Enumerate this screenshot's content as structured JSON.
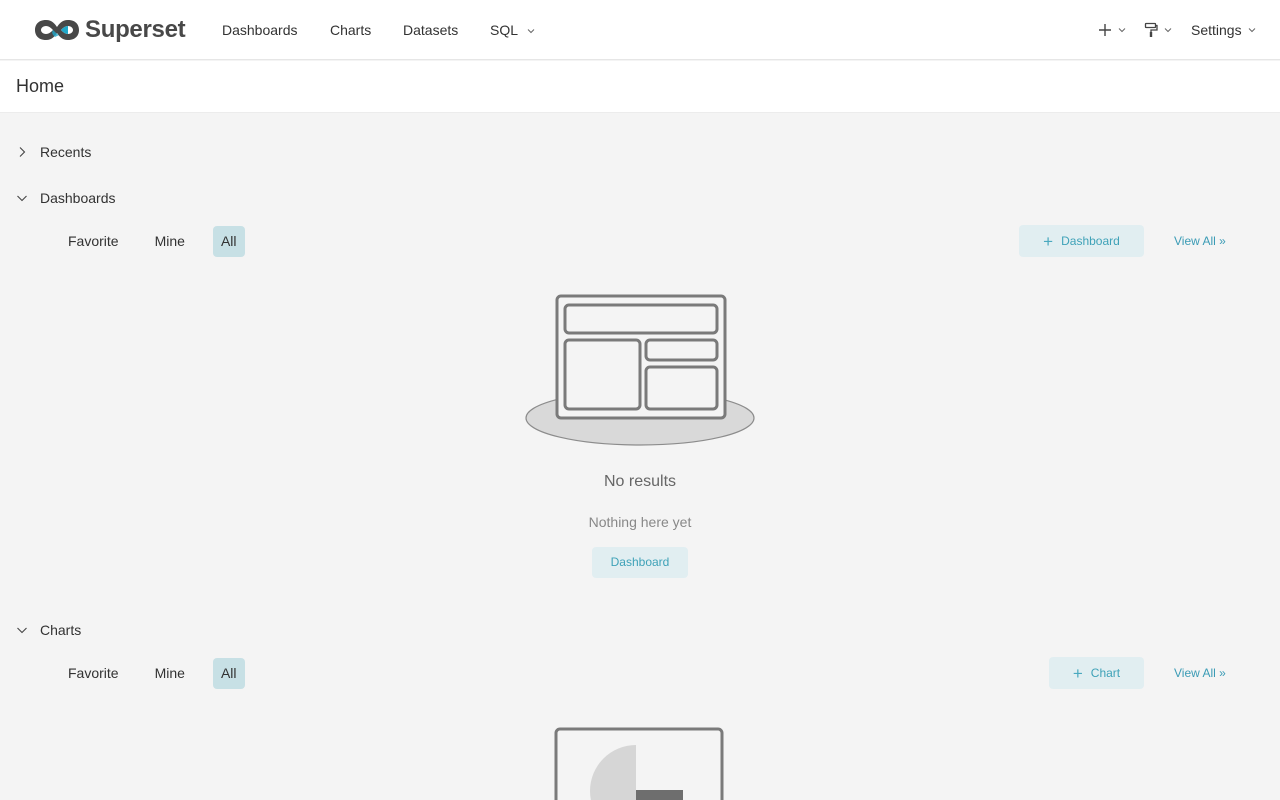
{
  "app": {
    "name": "Superset"
  },
  "nav": {
    "links": [
      "Dashboards",
      "Charts",
      "Datasets"
    ],
    "sql": "SQL",
    "settings": "Settings"
  },
  "page": {
    "title": "Home"
  },
  "sections": {
    "recents": {
      "label": "Recents"
    },
    "dashboards": {
      "label": "Dashboards",
      "tabs": [
        "Favorite",
        "Mine",
        "All"
      ],
      "active_tab": "All",
      "add_label": "Dashboard",
      "view_all": "View All »",
      "empty_title": "No results",
      "empty_sub": "Nothing here yet",
      "empty_button": "Dashboard"
    },
    "charts": {
      "label": "Charts",
      "tabs": [
        "Favorite",
        "Mine",
        "All"
      ],
      "active_tab": "All",
      "add_label": "Chart",
      "view_all": "View All »"
    }
  },
  "colors": {
    "accent": "#20a7c9",
    "active_tab": "#c7e0e5",
    "button_bg": "#e1eef1",
    "page_bg": "#f4f4f4"
  },
  "icons": [
    "superset-logo-icon",
    "plus-icon",
    "paint-roller-icon",
    "chevron-down-icon",
    "chevron-right-icon",
    "empty-dashboard-illustration",
    "empty-chart-illustration"
  ]
}
